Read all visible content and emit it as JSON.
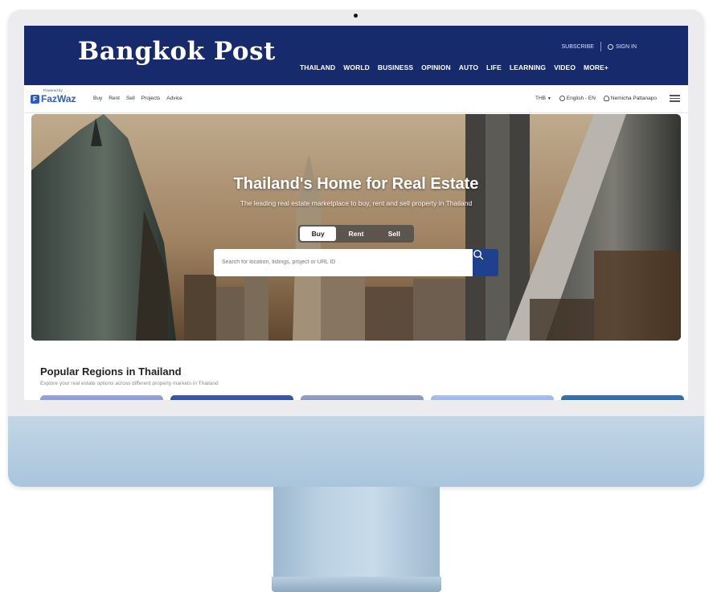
{
  "header": {
    "logo": "Bangkok Post",
    "subscribe": "SUBSCRIBE",
    "sign_in": "SIGN IN",
    "nav": [
      "THAILAND",
      "WORLD",
      "BUSINESS",
      "OPINION",
      "AUTO",
      "LIFE",
      "LEARNING",
      "VIDEO",
      "MORE+"
    ],
    "brand_color": "#172a6b"
  },
  "fazwaz": {
    "powered_by": "Powered by",
    "logo": "FazWaz",
    "logo_mark": "F",
    "links": [
      "Buy",
      "Rent",
      "Sell",
      "Projects",
      "Advice"
    ],
    "currency": "THB",
    "language": "English - EN",
    "user": "Nemicha Pattanapo",
    "accent_color": "#2a5dc4"
  },
  "hero": {
    "title": "Thailand's Home for Real Estate",
    "subtitle": "The leading real estate marketplace to buy, rent and sell property in Thailand",
    "tabs": [
      "Buy",
      "Rent",
      "Sell"
    ],
    "active_tab": "Buy",
    "search_placeholder": "Search for location, listings, project or URL ID",
    "search_button_color": "#1f3f8f"
  },
  "popular": {
    "title": "Popular Regions in Thailand",
    "subtitle": "Explore your real estate options across different property markets in Thailand",
    "card_colors": [
      "#7f8fcf",
      "#2f4b9a",
      "#7f8bb8",
      "#8fb0e2",
      "#2b5f9a"
    ]
  }
}
